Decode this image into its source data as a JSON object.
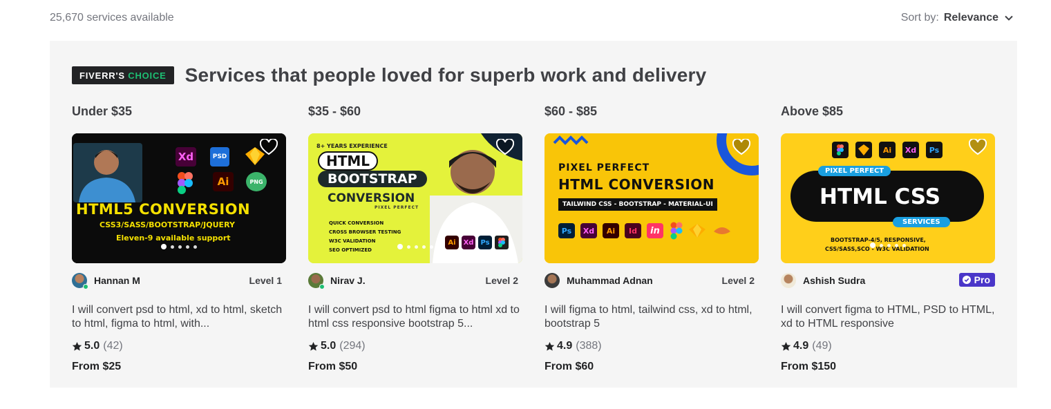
{
  "results": {
    "count_label": "25,670 services available",
    "sort_label": "Sort by:",
    "sort_value": "Relevance"
  },
  "choice": {
    "badge_part1": "FIVERR'S",
    "badge_part2": "CHOICE",
    "title": "Services that people loved for superb work and delivery"
  },
  "colors": {
    "accent": "#1dbf73",
    "pro": "#4a36c9",
    "panel_bg": "#f5f5f5"
  },
  "columns": [
    {
      "range": "Under $35",
      "seller": "Hannan M",
      "level": "Level 1",
      "online": true,
      "title": "I will convert psd to html, xd to html, sketch to html, figma to html, with...",
      "score": "5.0",
      "reviews": "(42)",
      "price": "From $25",
      "image": {
        "line1": "HTML5 CONVERSION",
        "line2": "CSS3/SASS/BOOTSTRAP/JQUERY",
        "line3": "Eleven-9 available support",
        "icons": [
          "Xd",
          "PSD",
          "Ai",
          "PNG"
        ]
      }
    },
    {
      "range": "$35 - $60",
      "seller": "Nirav J.",
      "level": "Level 2",
      "online": true,
      "title": "I will convert psd to html figma to html xd to html css responsive bootstrap 5...",
      "score": "5.0",
      "reviews": "(294)",
      "price": "From $50",
      "image": {
        "top": "8+ YEARS EXPERIENCE",
        "html": "HTML",
        "bootstrap": "BOOTSTRAP",
        "conversion": "CONVERSION",
        "pixel": "PIXEL PERFECT",
        "bullets": [
          "QUICK CONVERSION",
          "CROSS BROWSER TESTING",
          "W3C VALIDATION",
          "SEO OPTIMIZED"
        ],
        "icons": [
          "Ai",
          "Xd",
          "Ps"
        ]
      }
    },
    {
      "range": "$60 - $85",
      "seller": "Muhammad Adnan",
      "level": "Level 2",
      "online": false,
      "title": "I will figma to html, tailwind css, xd to html, bootstrap 5",
      "score": "4.9",
      "reviews": "(388)",
      "price": "From $60",
      "image": {
        "line1": "PIXEL PERFECT",
        "line2": "HTML CONVERSION",
        "bar": "TAILWIND CSS - BOOTSTRAP - MATERIAL-UI",
        "icons": [
          "Ps",
          "Xd",
          "Ai",
          "Id",
          "in"
        ]
      }
    },
    {
      "range": "Above $85",
      "seller": "Ashish Sudra",
      "badge": "Pro",
      "online": false,
      "title": "I will convert figma to HTML, PSD to HTML, xd to HTML responsive",
      "score": "4.9",
      "reviews": "(49)",
      "price": "From $150",
      "image": {
        "pixel": "PIXEL PERFECT",
        "main": "HTML CSS",
        "services": "SERVICES",
        "bottom1": "BOOTSTRAP-4/5, RESPONSIVE,",
        "bottom2": "CSS/SASS,SCO - W3C VALIDATION",
        "icons": [
          "Ai",
          "Xd",
          "Ps"
        ]
      }
    }
  ]
}
